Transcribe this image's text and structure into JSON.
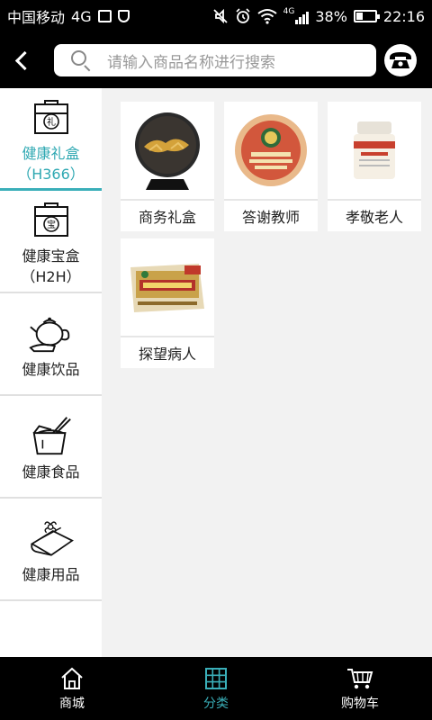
{
  "status_bar": {
    "carrier": "中国移动",
    "network": "4G",
    "signal_label": "4G",
    "battery": "38%",
    "battery_level": 0.38,
    "time": "22:16"
  },
  "search": {
    "placeholder": "请输入商品名称进行搜索"
  },
  "sidebar": {
    "items": [
      {
        "label_line1": "健康礼盒",
        "label_line2": "（H366）",
        "icon": "gift-box-li-icon",
        "active": true
      },
      {
        "label_line1": "健康宝盒",
        "label_line2": "（H2H）",
        "icon": "gift-box-bao-icon",
        "active": false
      },
      {
        "label_line1": "健康饮品",
        "label_line2": "",
        "icon": "teapot-icon",
        "active": false
      },
      {
        "label_line1": "健康食品",
        "label_line2": "",
        "icon": "food-box-icon",
        "active": false
      },
      {
        "label_line1": "健康用品",
        "label_line2": "",
        "icon": "towel-icon",
        "active": false
      }
    ]
  },
  "products": [
    {
      "label": "商务礼盒",
      "image": "tea-cake-plate-image"
    },
    {
      "label": "答谢教师",
      "image": "tea-cake-image"
    },
    {
      "label": "孝敬老人",
      "image": "supplement-jar-image"
    },
    {
      "label": "探望病人",
      "image": "ginseng-box-image"
    }
  ],
  "bottom_nav": {
    "items": [
      {
        "label": "商城",
        "icon": "home-icon",
        "active": false
      },
      {
        "label": "分类",
        "icon": "category-grid-icon",
        "active": true
      },
      {
        "label": "购物车",
        "icon": "cart-icon",
        "active": false
      }
    ]
  },
  "colors": {
    "accent": "#3aafb9",
    "bar_background": "#000000",
    "content_background": "#f2f2f2"
  }
}
